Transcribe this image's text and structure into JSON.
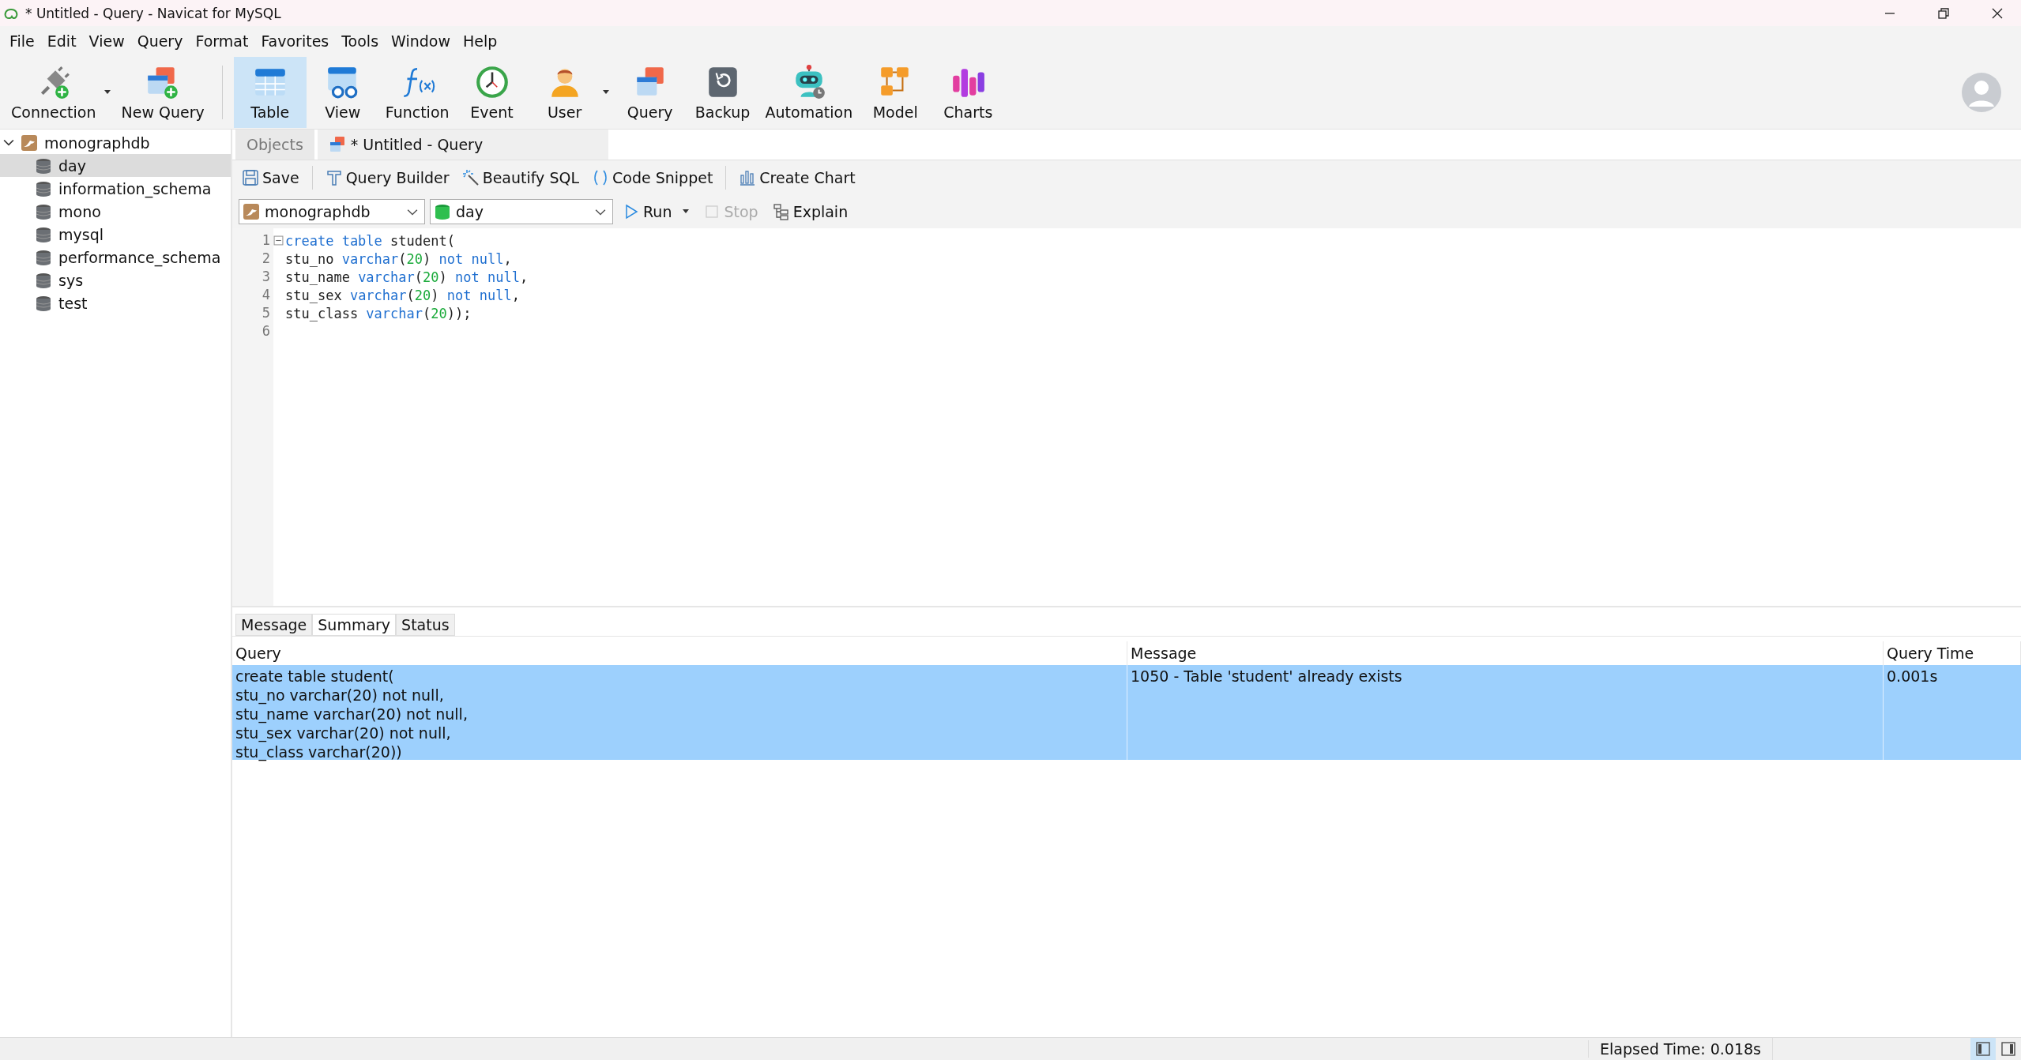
{
  "window": {
    "title": "* Untitled - Query - Navicat for MySQL"
  },
  "menu": [
    "File",
    "Edit",
    "View",
    "Query",
    "Format",
    "Favorites",
    "Tools",
    "Window",
    "Help"
  ],
  "toolbar": [
    {
      "kind": "connection",
      "label": "Connection",
      "selected": false,
      "dropdown": true
    },
    {
      "kind": "new-query",
      "label": "New Query",
      "selected": false,
      "dropdown": false
    },
    {
      "kind": "table",
      "label": "Table",
      "selected": true,
      "dropdown": false
    },
    {
      "kind": "view",
      "label": "View",
      "selected": false,
      "dropdown": false
    },
    {
      "kind": "function",
      "label": "Function",
      "selected": false,
      "dropdown": false
    },
    {
      "kind": "event",
      "label": "Event",
      "selected": false,
      "dropdown": false
    },
    {
      "kind": "user",
      "label": "User",
      "selected": false,
      "dropdown": true
    },
    {
      "kind": "query",
      "label": "Query",
      "selected": false,
      "dropdown": false
    },
    {
      "kind": "backup",
      "label": "Backup",
      "selected": false,
      "dropdown": false
    },
    {
      "kind": "automation",
      "label": "Automation",
      "selected": false,
      "dropdown": false
    },
    {
      "kind": "model",
      "label": "Model",
      "selected": false,
      "dropdown": false
    },
    {
      "kind": "charts",
      "label": "Charts",
      "selected": false,
      "dropdown": false
    }
  ],
  "sidebar": {
    "connection": {
      "label": "monographdb",
      "expanded": true,
      "children": [
        {
          "label": "day",
          "selected": true
        },
        {
          "label": "information_schema",
          "selected": false
        },
        {
          "label": "mono",
          "selected": false
        },
        {
          "label": "mysql",
          "selected": false
        },
        {
          "label": "performance_schema",
          "selected": false
        },
        {
          "label": "sys",
          "selected": false
        },
        {
          "label": "test",
          "selected": false
        }
      ]
    }
  },
  "tabs": [
    {
      "label": "Objects",
      "selected": false,
      "kind": "objects"
    },
    {
      "label": "* Untitled - Query",
      "selected": true,
      "kind": "query"
    }
  ],
  "query_toolbar": [
    {
      "kind": "save",
      "label": "Save"
    },
    {
      "kind": "builder",
      "label": "Query Builder"
    },
    {
      "kind": "beautify",
      "label": "Beautify SQL"
    },
    {
      "kind": "snippet",
      "label": "Code Snippet"
    },
    {
      "kind": "chart",
      "label": "Create Chart"
    }
  ],
  "selectors": {
    "connection": "monographdb",
    "database": "day"
  },
  "run_bar": [
    {
      "kind": "run",
      "label": "Run",
      "disabled": false
    },
    {
      "kind": "stop",
      "label": "Stop",
      "disabled": true
    },
    {
      "kind": "explain",
      "label": "Explain",
      "disabled": false
    }
  ],
  "editor": {
    "lines": [
      {
        "number": "1",
        "tokens": [
          {
            "kind": "keyword",
            "text": "create table"
          },
          {
            "kind": "plain",
            "text": " student("
          }
        ]
      },
      {
        "number": "2",
        "tokens": [
          {
            "kind": "plain",
            "text": "stu_no "
          },
          {
            "kind": "keyword",
            "text": "varchar"
          },
          {
            "kind": "plain",
            "text": "("
          },
          {
            "kind": "number",
            "text": "20"
          },
          {
            "kind": "plain",
            "text": ") "
          },
          {
            "kind": "keyword",
            "text": "not null"
          },
          {
            "kind": "plain",
            "text": ","
          }
        ]
      },
      {
        "number": "3",
        "tokens": [
          {
            "kind": "plain",
            "text": "stu_name "
          },
          {
            "kind": "keyword",
            "text": "varchar"
          },
          {
            "kind": "plain",
            "text": "("
          },
          {
            "kind": "number",
            "text": "20"
          },
          {
            "kind": "plain",
            "text": ") "
          },
          {
            "kind": "keyword",
            "text": "not null"
          },
          {
            "kind": "plain",
            "text": ","
          }
        ]
      },
      {
        "number": "4",
        "tokens": [
          {
            "kind": "plain",
            "text": "stu_sex "
          },
          {
            "kind": "keyword",
            "text": "varchar"
          },
          {
            "kind": "plain",
            "text": "("
          },
          {
            "kind": "number",
            "text": "20"
          },
          {
            "kind": "plain",
            "text": ") "
          },
          {
            "kind": "keyword",
            "text": "not null"
          },
          {
            "kind": "plain",
            "text": ","
          }
        ]
      },
      {
        "number": "5",
        "tokens": [
          {
            "kind": "plain",
            "text": "stu_class "
          },
          {
            "kind": "keyword",
            "text": "varchar"
          },
          {
            "kind": "plain",
            "text": "("
          },
          {
            "kind": "number",
            "text": "20"
          },
          {
            "kind": "plain",
            "text": "));"
          }
        ]
      },
      {
        "number": "6"
      }
    ]
  },
  "result_tabs": [
    {
      "label": "Message",
      "selected": false
    },
    {
      "label": "Summary",
      "selected": true
    },
    {
      "label": "Status",
      "selected": false
    }
  ],
  "table": {
    "columns": [
      "Query",
      "Message",
      "Query Time"
    ],
    "rows": [
      {
        "selected": true,
        "query": [
          "create table student(",
          "stu_no varchar(20) not null,",
          "stu_name varchar(20) not null,",
          "stu_sex varchar(20) not null,",
          "stu_class varchar(20))"
        ],
        "message": "1050 - Table 'student' already exists",
        "query_time": "0.001s"
      }
    ]
  },
  "status_bar": {
    "elapsed": "Elapsed Time: 0.018s",
    "layout_left_selected": true
  }
}
